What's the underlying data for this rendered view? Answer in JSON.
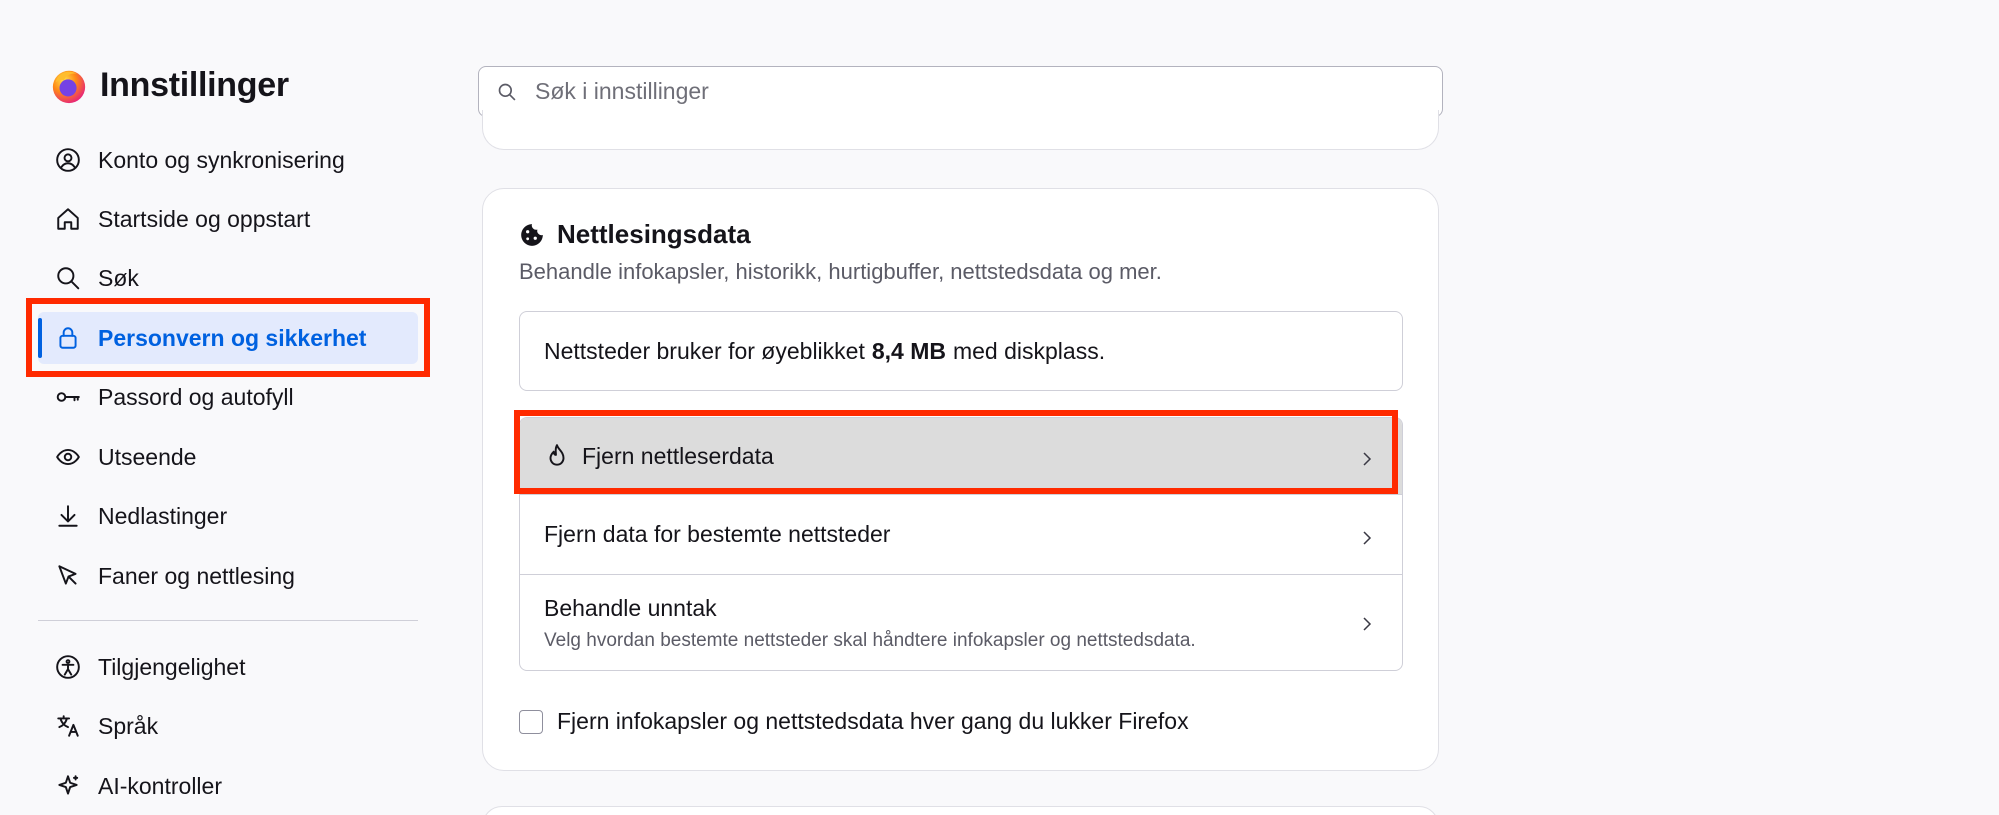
{
  "app": {
    "title": "Innstillinger"
  },
  "search": {
    "placeholder": "Søk i innstillinger",
    "value": ""
  },
  "sidebar": {
    "items": [
      {
        "label": "Konto og synkronisering",
        "icon": "account-icon"
      },
      {
        "label": "Startside og oppstart",
        "icon": "home-icon"
      },
      {
        "label": "Søk",
        "icon": "search-icon"
      },
      {
        "label": "Personvern og sikkerhet",
        "icon": "lock-icon",
        "active": true
      },
      {
        "label": "Passord og autofyll",
        "icon": "key-icon"
      },
      {
        "label": "Utseende",
        "icon": "eye-icon"
      },
      {
        "label": "Nedlastinger",
        "icon": "download-icon"
      },
      {
        "label": "Faner og nettlesing",
        "icon": "cursor-icon"
      },
      {
        "label": "Tilgjengelighet",
        "icon": "accessibility-icon"
      },
      {
        "label": "Språk",
        "icon": "translate-icon"
      },
      {
        "label": "AI-kontroller",
        "icon": "sparkle-icon"
      }
    ]
  },
  "browsing_data": {
    "title": "Nettlesingsdata",
    "description": "Behandle infokapsler, historikk, hurtigbuffer, nettstedsdata og mer.",
    "usage_prefix": "Nettsteder bruker for øyeblikket",
    "usage_value": "8,4 MB",
    "usage_suffix": "med diskplass.",
    "rows": [
      {
        "label": "Fjern nettleserdata"
      },
      {
        "label": "Fjern data for bestemte nettsteder"
      },
      {
        "label": "Behandle unntak",
        "description": "Velg hvordan bestemte nettsteder skal håndtere infokapsler og nettstedsdata."
      }
    ],
    "checkbox_label": "Fjern infokapsler og nettstedsdata hver gang du lukker Firefox",
    "checkbox_checked": false
  },
  "colors": {
    "accent": "#0061e0",
    "active_bg": "#e3eafd",
    "highlight": "#ff2a00",
    "hover_row": "#dcdcdc"
  }
}
